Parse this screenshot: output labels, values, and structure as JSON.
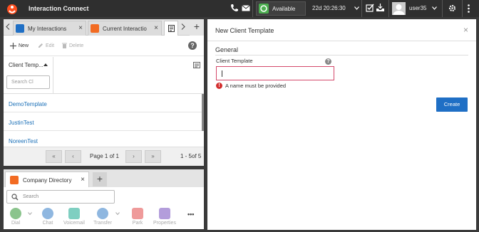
{
  "app": {
    "title": "Interaction Connect"
  },
  "topbar": {
    "status": "Available",
    "timer": "22d 20:26:30",
    "username": "user35"
  },
  "tabs": [
    {
      "label": "My Interactions",
      "color": "#1f6fc5"
    },
    {
      "label": "Current Interactio",
      "color": "#f26b22"
    }
  ],
  "toolbar": {
    "new_label": "New",
    "edit_label": "Edit",
    "delete_label": "Delete"
  },
  "table": {
    "column_header": "Client Temp...",
    "search_placeholder": "Search Cl",
    "rows": [
      "DemoTemplate",
      "JustinTest",
      "NoreenTest"
    ]
  },
  "pager": {
    "first": "«",
    "prev": "‹",
    "page_text": "Page 1 of 1",
    "next": "›",
    "last": "»",
    "range": "1 - 5of 5"
  },
  "directory": {
    "tab_label": "Company Directory",
    "search_placeholder": "Search",
    "actions": [
      "Dial",
      "Chat",
      "Voicemail",
      "Transfer",
      "Park",
      "Properties"
    ],
    "more": "•••"
  },
  "dialog": {
    "title": "New Client Template",
    "close": "×",
    "section": "General",
    "field_label": "Client Template",
    "field_value": "",
    "error": "A name must be provided",
    "create_label": "Create"
  }
}
